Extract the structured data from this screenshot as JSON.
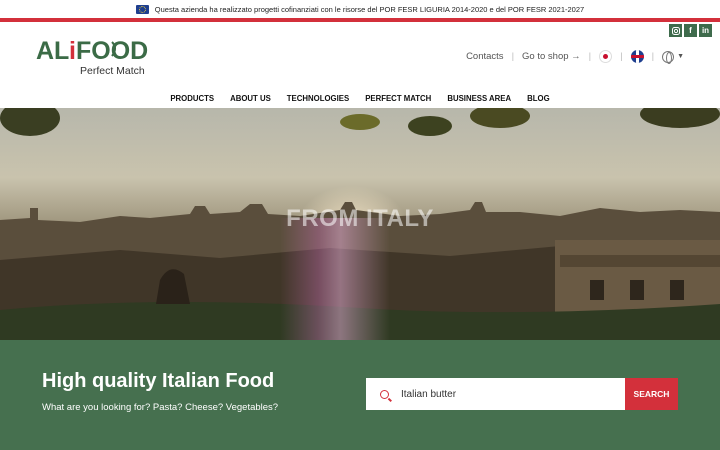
{
  "eu_bar": {
    "text": "Questa azienda ha realizzato progetti cofinanziati con le risorse del POR FESR LIGURIA 2014-2020 e del POR FESR 2021-2027"
  },
  "logo": {
    "main": "ALiFOOD",
    "sub": "Perfect Match"
  },
  "social": [
    "instagram-icon",
    "facebook-icon",
    "linkedin-icon"
  ],
  "util": {
    "contacts": "Contacts",
    "shop": "Go to shop →"
  },
  "nav": [
    "PRODUCTS",
    "ABOUT US",
    "TECHNOLOGIES",
    "PERFECT MATCH",
    "BUSINESS AREA",
    "BLOG"
  ],
  "hero": {
    "title": "FROM ITALY"
  },
  "band": {
    "title": "High quality Italian Food",
    "subtitle": "What are you looking for? Pasta? Cheese? Vegetables?"
  },
  "search": {
    "placeholder": "Italian butter",
    "button": "SEARCH"
  },
  "colors": {
    "brand_green": "#46704f",
    "brand_red": "#d3303b"
  }
}
